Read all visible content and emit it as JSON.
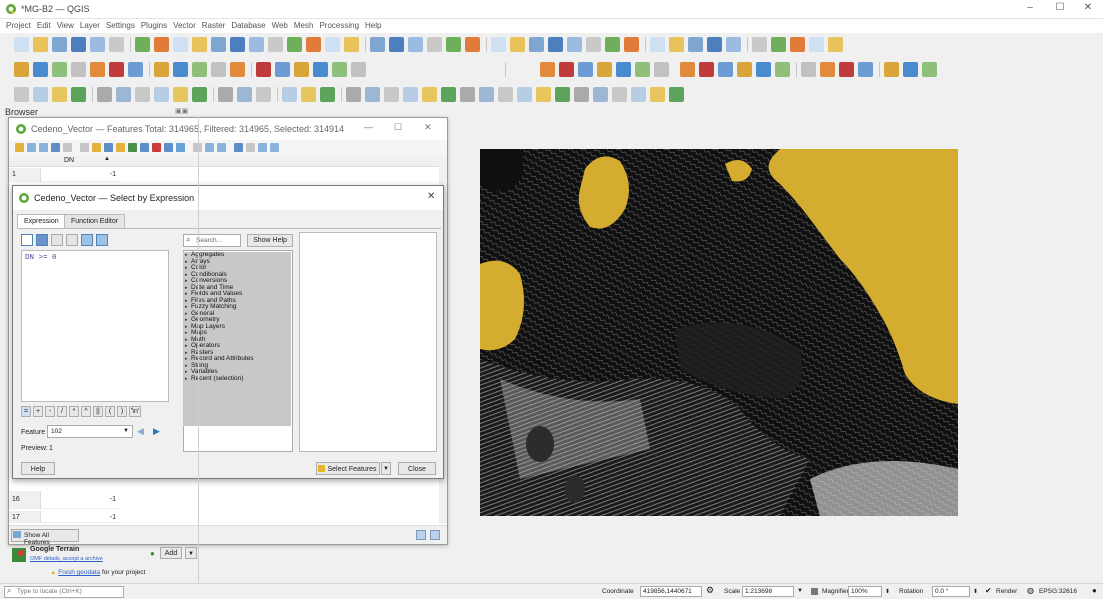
{
  "window": {
    "title": "*MG-B2 — QGIS"
  },
  "menubar": [
    "Project",
    "Edit",
    "View",
    "Layer",
    "Settings",
    "Plugins",
    "Vector",
    "Raster",
    "Database",
    "Web",
    "Mesh",
    "Processing",
    "Help"
  ],
  "browser": {
    "label": "Browser"
  },
  "attribute_table": {
    "title": "Cedeno_Vector — Features Total: 314965, Filtered: 314965, Selected: 314914",
    "column_header": "DN",
    "rows": [
      {
        "num": "1",
        "dn": "-1"
      },
      {
        "num": "16",
        "dn": "-1"
      },
      {
        "num": "17",
        "dn": "-1"
      }
    ],
    "show_all_label": "Show All Features"
  },
  "select_dialog": {
    "title": "Cedeno_Vector — Select by Expression",
    "tabs": [
      "Expression",
      "Function Editor"
    ],
    "expression": "DN >= 0",
    "search_placeholder": "Search...",
    "show_help_label": "Show Help",
    "operators": [
      "=",
      "+",
      "-",
      "/",
      "*",
      "^",
      "||",
      "(",
      ")",
      "'\\n'"
    ],
    "function_groups": [
      "Aggregates",
      "Arrays",
      "Color",
      "Conditionals",
      "Conversions",
      "Date and Time",
      "Fields and Values",
      "Files and Paths",
      "Fuzzy Matching",
      "General",
      "Geometry",
      "Map Layers",
      "Maps",
      "Math",
      "Operators",
      "Rasters",
      "Record and Attributes",
      "String",
      "Variables",
      "Recent (selection)"
    ],
    "feature_label": "Feature",
    "feature_value": "102",
    "preview_label": "Preview:",
    "preview_value": "1",
    "help_label": "Help",
    "select_features_label": "Select Features",
    "close_label": "Close"
  },
  "browser_panel": {
    "google_terrain": "Google Terrain",
    "terrain_sub": "OMF details, accept a archive",
    "add_label": "Add",
    "fresh_geodata": "Fresh geodata",
    "for_project": "for your project"
  },
  "status": {
    "locate_placeholder": "Type to locate (Ctrl+K)",
    "coordinate_label": "Coordinate",
    "coordinate_value": "419856,1440671",
    "scale_label": "Scale",
    "scale_value": "1:213698",
    "magnifier_label": "Magnifier",
    "magnifier_value": "100%",
    "rotation_label": "Rotation",
    "rotation_value": "0.0 °",
    "render_label": "Render",
    "crs_label": "EPSG:32616"
  },
  "colors": {
    "map_fill": "#d4ac2f",
    "map_bg": "#0f0f0f",
    "accent": "#2a7ab8"
  }
}
